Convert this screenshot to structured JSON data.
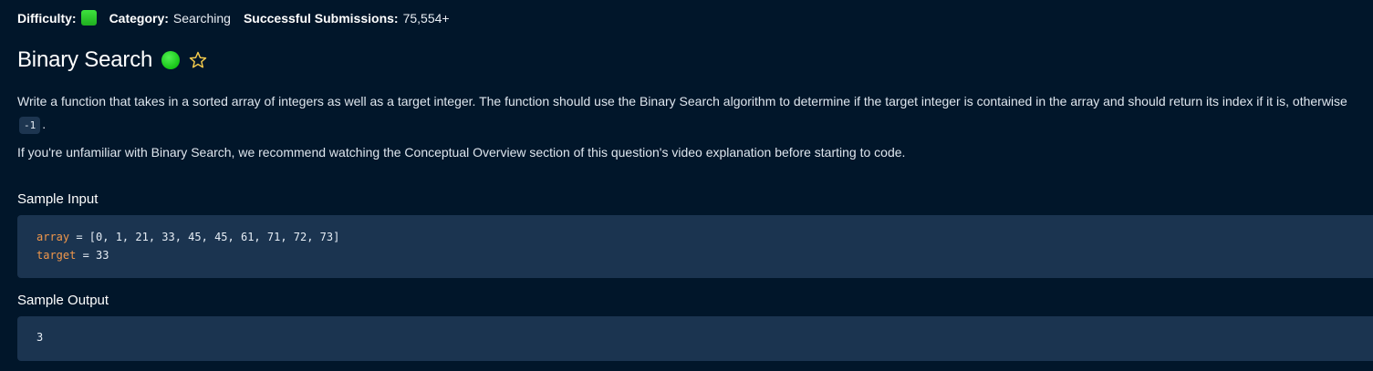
{
  "meta": {
    "difficulty_label": "Difficulty:",
    "category_label": "Category:",
    "category_value": "Searching",
    "submissions_label": "Successful Submissions:",
    "submissions_value": "75,554+"
  },
  "problem": {
    "title": "Binary Search",
    "description_part1": "Write a function that takes in a sorted array of integers as well as a target integer. The function should use the Binary Search algorithm to determine if the target integer is contained in the array and should return its index if it is, otherwise ",
    "description_code": "-1",
    "description_part2": ".",
    "note": "If you're unfamiliar with Binary Search, we recommend watching the Conceptual Overview section of this question's video explanation before starting to code."
  },
  "sample_input": {
    "title": "Sample Input",
    "lines": [
      {
        "var": "array",
        "rest": " = [0, 1, 21, 33, 45, 45, 61, 71, 72, 73]"
      },
      {
        "var": "target",
        "rest": " = 33"
      }
    ]
  },
  "sample_output": {
    "title": "Sample Output",
    "value": "3"
  },
  "colors": {
    "background": "#01162a",
    "code_background": "#1b3450",
    "variable": "#f0974b",
    "easy_green": "#2ed12e"
  },
  "icons": {
    "difficulty": "easy-difficulty-badge",
    "status": "completed-status-dot",
    "favorite": "star-outline-icon"
  }
}
